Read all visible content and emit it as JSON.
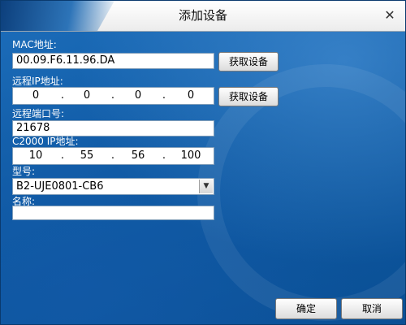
{
  "window": {
    "title": "添加设备",
    "close_symbol": "✕"
  },
  "form": {
    "mac_label": "MAC地址:",
    "mac_value": "00.09.F6.11.96.DA",
    "remote_ip_label": "远程IP地址:",
    "remote_ip": [
      "0",
      "0",
      "0",
      "0"
    ],
    "remote_port_label": "远程端口号:",
    "remote_port_value": "21678",
    "c2000_ip_label": "C2000 IP地址:",
    "c2000_ip": [
      "10",
      "55",
      "56",
      "100"
    ],
    "ip_separator": ".",
    "model_label": "型号:",
    "model_value": "B2-UJE0801-CB6",
    "name_label": "名称:",
    "name_value": ""
  },
  "buttons": {
    "fetch_device_1": "获取设备",
    "fetch_device_2": "获取设备",
    "ok": "确定",
    "cancel": "取消"
  },
  "icons": {
    "close": "close-icon",
    "dropdown": "chevron-down-icon"
  }
}
